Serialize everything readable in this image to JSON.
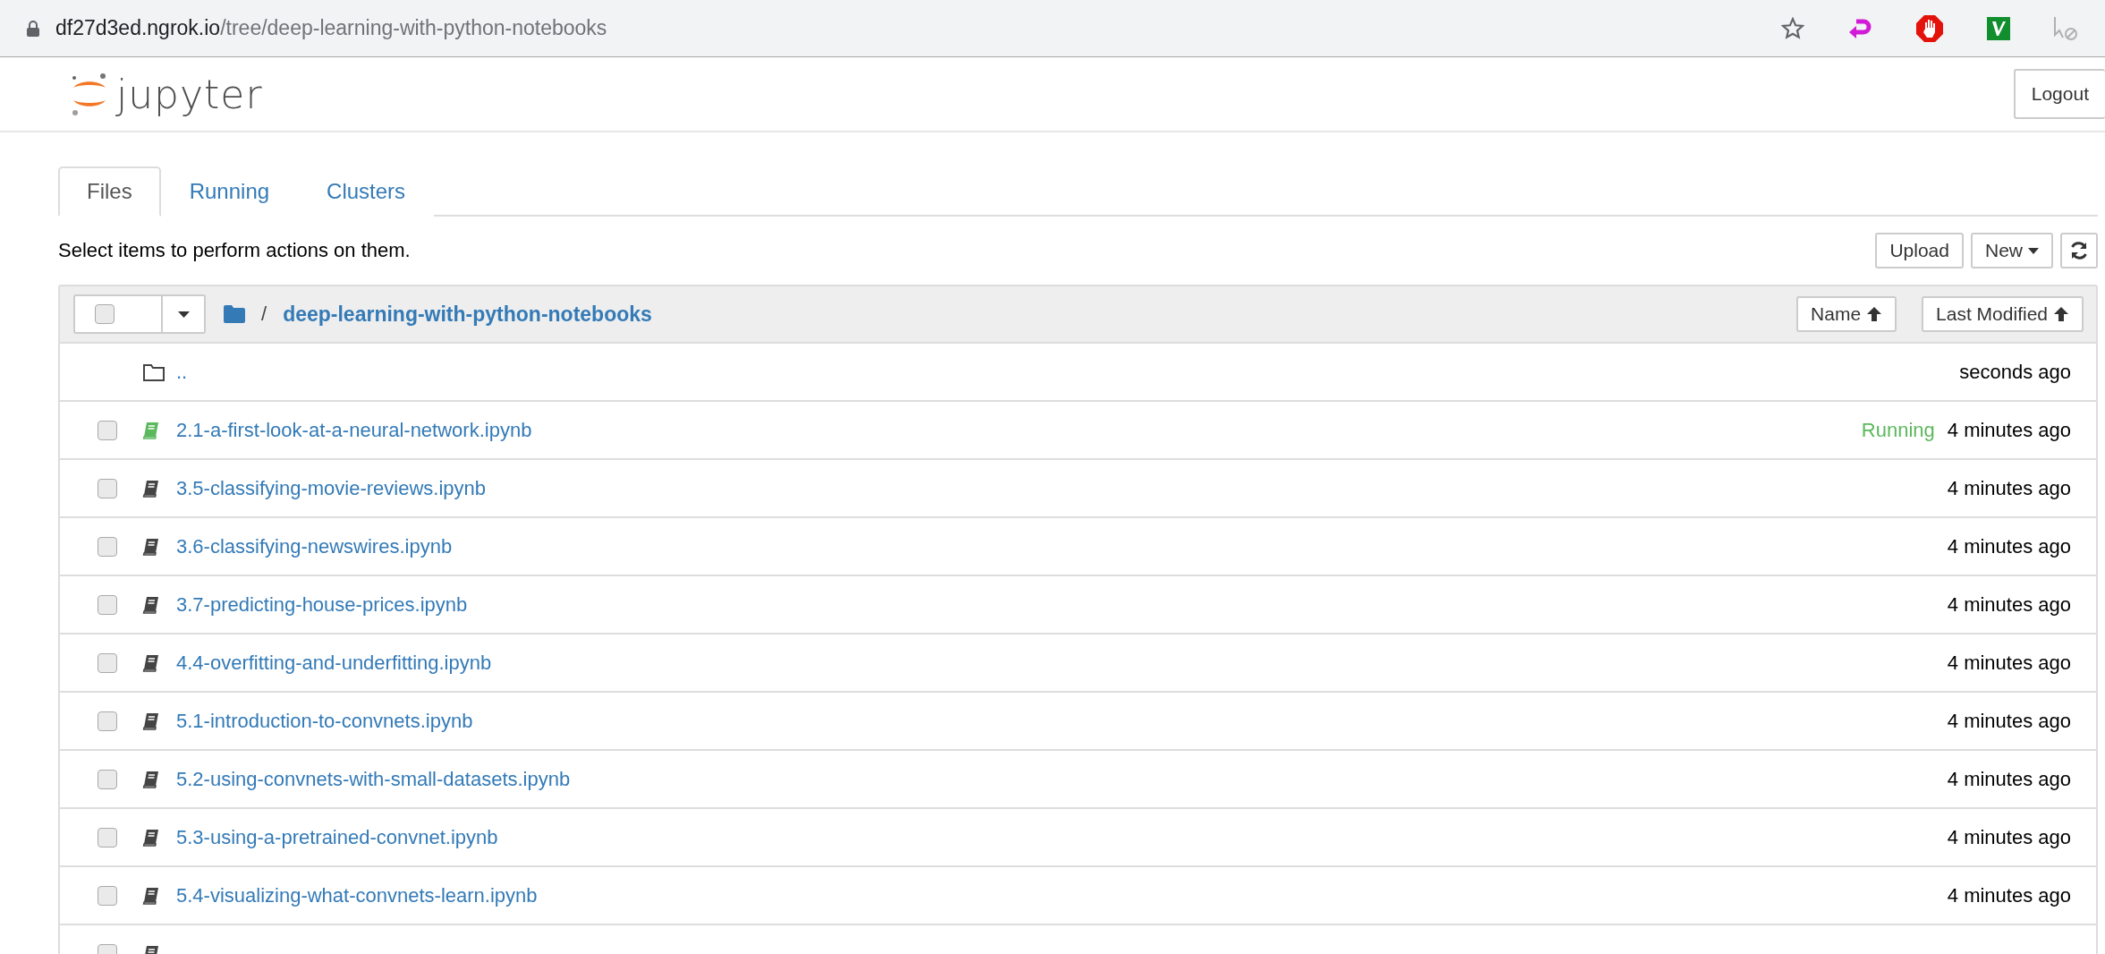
{
  "browser": {
    "url_host": "df27d3ed.ngrok.io",
    "url_path": "/tree/deep-learning-with-python-notebooks"
  },
  "header": {
    "logo_text": "jupyter",
    "logout": "Logout"
  },
  "tabs": [
    {
      "label": "Files",
      "selected": true
    },
    {
      "label": "Running",
      "selected": false
    },
    {
      "label": "Clusters",
      "selected": false
    }
  ],
  "toolbar": {
    "hint": "Select items to perform actions on them.",
    "upload": "Upload",
    "new": "New"
  },
  "list_header": {
    "select_all_checked": false,
    "separator": "/",
    "folder": "deep-learning-with-python-notebooks",
    "sort_name": "Name",
    "sort_modified": "Last Modified"
  },
  "rows": [
    {
      "kind": "parent",
      "name": "..",
      "modified": "seconds ago"
    },
    {
      "kind": "notebook",
      "checked": false,
      "running": true,
      "status": "Running",
      "name": "2.1-a-first-look-at-a-neural-network.ipynb",
      "modified": "4 minutes ago"
    },
    {
      "kind": "notebook",
      "checked": false,
      "running": false,
      "name": "3.5-classifying-movie-reviews.ipynb",
      "modified": "4 minutes ago"
    },
    {
      "kind": "notebook",
      "checked": false,
      "running": false,
      "name": "3.6-classifying-newswires.ipynb",
      "modified": "4 minutes ago"
    },
    {
      "kind": "notebook",
      "checked": false,
      "running": false,
      "name": "3.7-predicting-house-prices.ipynb",
      "modified": "4 minutes ago"
    },
    {
      "kind": "notebook",
      "checked": false,
      "running": false,
      "name": "4.4-overfitting-and-underfitting.ipynb",
      "modified": "4 minutes ago"
    },
    {
      "kind": "notebook",
      "checked": false,
      "running": false,
      "name": "5.1-introduction-to-convnets.ipynb",
      "modified": "4 minutes ago"
    },
    {
      "kind": "notebook",
      "checked": false,
      "running": false,
      "name": "5.2-using-convnets-with-small-datasets.ipynb",
      "modified": "4 minutes ago"
    },
    {
      "kind": "notebook",
      "checked": false,
      "running": false,
      "name": "5.3-using-a-pretrained-convnet.ipynb",
      "modified": "4 minutes ago"
    },
    {
      "kind": "notebook",
      "checked": false,
      "running": false,
      "name": "5.4-visualizing-what-convnets-learn.ipynb",
      "modified": "4 minutes ago"
    },
    {
      "kind": "notebook",
      "checked": false,
      "running": false
    }
  ]
}
